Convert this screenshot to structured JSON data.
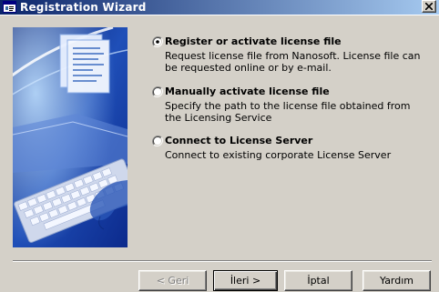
{
  "window": {
    "title": "Registration Wizard",
    "icon": "registration-wizard-icon",
    "titlebar_gradient_start": "#0a246a",
    "titlebar_gradient_end": "#a6caf0"
  },
  "options": [
    {
      "label": "Register or activate license file",
      "description": "Request license file from Nanosoft. License file can be requested online or by e-mail.",
      "selected": true
    },
    {
      "label": "Manually activate license file",
      "description": "Specify the path to the license file obtained from the Licensing Service",
      "selected": false
    },
    {
      "label": "Connect to License Server",
      "description": "Connect to existing corporate License Server",
      "selected": false
    }
  ],
  "buttons": {
    "back": {
      "label": "< Geri",
      "enabled": false
    },
    "next": {
      "label": "İleri >",
      "enabled": true
    },
    "cancel": {
      "label": "İptal",
      "enabled": true
    },
    "help": {
      "label": "Yardım",
      "enabled": true
    }
  }
}
